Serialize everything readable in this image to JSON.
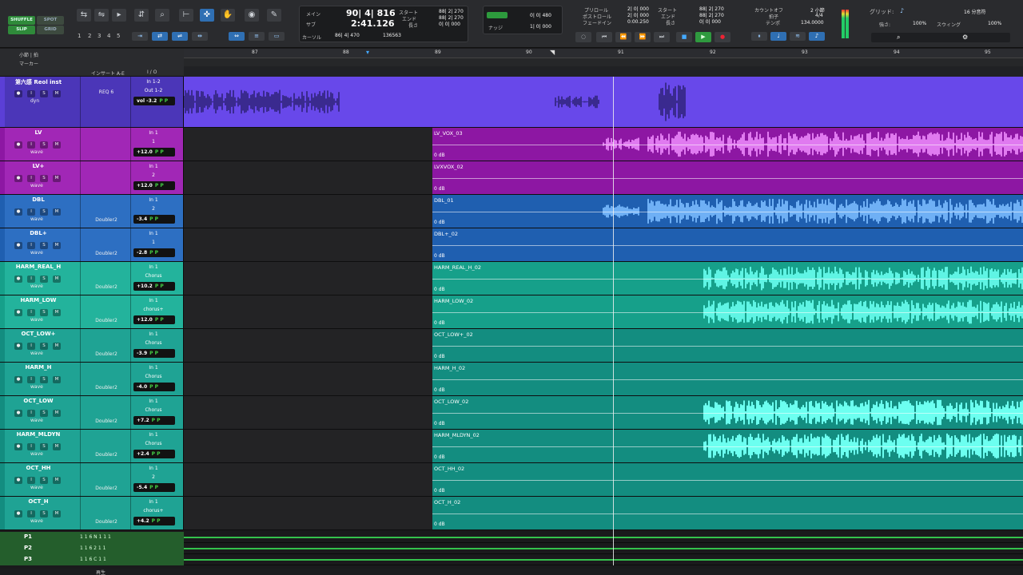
{
  "toolbar": {
    "modes": [
      "SHUFFLE",
      "SPOT",
      "SLIP",
      "GRID"
    ],
    "zoom_presets": [
      "1",
      "2",
      "3",
      "4",
      "5"
    ],
    "counter": {
      "main_label": "メイン",
      "main_value": "90| 4| 816",
      "sub_label": "サブ",
      "sub_value": "2:41.126",
      "cursor_label": "カーソル",
      "cursor_value": "86| 4| 470",
      "sample_value": "136563",
      "start_label": "スタート",
      "end_label": "エンド",
      "length_label": "長さ",
      "start_value": "88| 2| 270",
      "end_value": "88| 2| 270",
      "length_value": "0| 0| 000"
    },
    "nudge": {
      "value1": "0| 0| 480",
      "value2": "1| 0| 000",
      "label": "ナッジ"
    },
    "preroll": {
      "preroll_label": "プリロール",
      "postroll_label": "ポストロール",
      "fade_label": "フェードイン",
      "preroll_value": "2| 0| 000",
      "postroll_value": "2| 0| 000",
      "fade_value": "0:00.250",
      "start_label": "スタート",
      "end_label": "エンド",
      "length_label": "長さ",
      "start_value": "88| 2| 270",
      "end_value": "88| 2| 270",
      "length_value": "0| 0| 000"
    },
    "tempo": {
      "countoff_label": "カウントオフ",
      "meter_label": "拍子",
      "tempo_label": "テンポ",
      "count_value": "2 小節",
      "meter_value": "4/4",
      "tempo_value": "134.0000"
    },
    "grid": {
      "grid_label": "グリッド:",
      "grid_value": "16 分音符",
      "quant_label": "強さ:",
      "quant_value": "100%",
      "swing_label": "スウィング",
      "swing_value": "100%"
    }
  },
  "ruler": {
    "bar_label": "小節 | 拍",
    "marker_label": "マーカー",
    "bars": [
      "87",
      "88",
      "89",
      "90",
      "91",
      "92",
      "93",
      "94",
      "95"
    ],
    "insert_header": "インサート A-E",
    "io_header": "I / O"
  },
  "tracks": [
    {
      "name": "第六感 Reol inst",
      "color": "#5b3fd6",
      "head": "#4b36b8",
      "ins1": "REQ 6",
      "ins2": "",
      "in": "In 1-2",
      "out": "Out 1-2",
      "vol": "vol -3.2",
      "view": "dyn",
      "clips": [
        {
          "name": "",
          "gain": "",
          "start": 0,
          "wave": "inst"
        }
      ]
    },
    {
      "name": "LV",
      "color": "#8d17a3",
      "head": "#a127b6",
      "ins1": "",
      "ins2": "",
      "in": "In 1",
      "out": "1",
      "vol": "+12.0",
      "view": "wave",
      "clips": [
        {
          "name": "LV_VOX_03",
          "gain": "0 dB",
          "start": 311,
          "wave": "lv"
        }
      ]
    },
    {
      "name": "LV+",
      "color": "#8d17a3",
      "head": "#a127b6",
      "ins1": "",
      "ins2": "",
      "in": "In 1",
      "out": "2",
      "vol": "+12.0",
      "view": "wave",
      "clips": [
        {
          "name": "LVXVOX_02",
          "gain": "0 dB",
          "start": 311,
          "wave": "none"
        }
      ]
    },
    {
      "name": "DBL",
      "color": "#1f5fb0",
      "head": "#2d6fc2",
      "ins1": "",
      "ins2": "Doubler2",
      "in": "In 1",
      "out": "2",
      "vol": "-3.4",
      "view": "wave",
      "clips": [
        {
          "name": "DBL_01",
          "gain": "0 dB",
          "start": 311,
          "wave": "dbl"
        }
      ]
    },
    {
      "name": "DBL+",
      "color": "#1f5fb0",
      "head": "#2d6fc2",
      "ins1": "",
      "ins2": "Doubler2",
      "in": "In 1",
      "out": "1",
      "vol": "-2.8",
      "view": "wave",
      "clips": [
        {
          "name": "DBL+_02",
          "gain": "0 dB",
          "start": 311,
          "wave": "none"
        }
      ]
    },
    {
      "name": "HARM_REAL_H",
      "color": "#16a08a",
      "head": "#23b39c",
      "ins1": "",
      "ins2": "Doubler2",
      "in": "In 1",
      "out": "Chorus",
      "vol": "+10.2",
      "view": "wave",
      "clips": [
        {
          "name": "HARM_REAL_H_02",
          "gain": "0 dB",
          "start": 311,
          "wave": "harm"
        }
      ]
    },
    {
      "name": "HARM_LOW",
      "color": "#16a08a",
      "head": "#23b39c",
      "ins1": "",
      "ins2": "Doubler2",
      "in": "In 1",
      "out": "chorus+",
      "vol": "+12.0",
      "view": "wave",
      "clips": [
        {
          "name": "HARM_LOW_02",
          "gain": "0 dB",
          "start": 311,
          "wave": "harm"
        }
      ]
    },
    {
      "name": "OCT_LOW+",
      "color": "#138d80",
      "head": "#1fa394",
      "ins1": "",
      "ins2": "Doubler2",
      "in": "In 1",
      "out": "Chorus",
      "vol": "-3.9",
      "view": "wave",
      "clips": [
        {
          "name": "OCT_LOW+_02",
          "gain": "0 dB",
          "start": 311,
          "wave": "none"
        }
      ]
    },
    {
      "name": "HARM_H",
      "color": "#138d80",
      "head": "#1fa394",
      "ins1": "",
      "ins2": "Doubler2",
      "in": "In 1",
      "out": "Chorus",
      "vol": "-4.0",
      "view": "wave",
      "clips": [
        {
          "name": "HARM_H_02",
          "gain": "0 dB",
          "start": 311,
          "wave": "none"
        }
      ]
    },
    {
      "name": "OCT_LOW",
      "color": "#138d80",
      "head": "#1fa394",
      "ins1": "",
      "ins2": "Doubler2",
      "in": "In 1",
      "out": "Chorus",
      "vol": "+7.2",
      "view": "wave",
      "clips": [
        {
          "name": "OCT_LOW_02",
          "gain": "0 dB",
          "start": 311,
          "wave": "oct"
        }
      ]
    },
    {
      "name": "HARM_MLDYN",
      "color": "#138d80",
      "head": "#1fa394",
      "ins1": "",
      "ins2": "Doubler2",
      "in": "In 1",
      "out": "Chorus",
      "vol": "+2.4",
      "view": "wave",
      "clips": [
        {
          "name": "HARM_MLDYN_02",
          "gain": "0 dB",
          "start": 311,
          "wave": "oct"
        }
      ]
    },
    {
      "name": "OCT_HH",
      "color": "#138d80",
      "head": "#1fa394",
      "ins1": "",
      "ins2": "Doubler2",
      "in": "In 1",
      "out": "2",
      "vol": "-5.4",
      "view": "wave",
      "clips": [
        {
          "name": "OCT_HH_02",
          "gain": "0 dB",
          "start": 311,
          "wave": "none"
        }
      ]
    },
    {
      "name": "OCT_H",
      "color": "#138d80",
      "head": "#1fa394",
      "ins1": "",
      "ins2": "Doubler2",
      "in": "In 1",
      "out": "chorus+",
      "vol": "+4.2",
      "view": "wave",
      "clips": [
        {
          "name": "OCT_H_02",
          "gain": "0 dB",
          "start": 311,
          "wave": "none"
        }
      ]
    }
  ],
  "mini_tracks": [
    {
      "name": "P1",
      "info": "1 1 6 N   1 1 1"
    },
    {
      "name": "P2",
      "info": "1 1 6   2 1 1"
    },
    {
      "name": "P3",
      "info": "1 1 6   C 1 1"
    }
  ],
  "footer": {
    "status": "再生"
  }
}
